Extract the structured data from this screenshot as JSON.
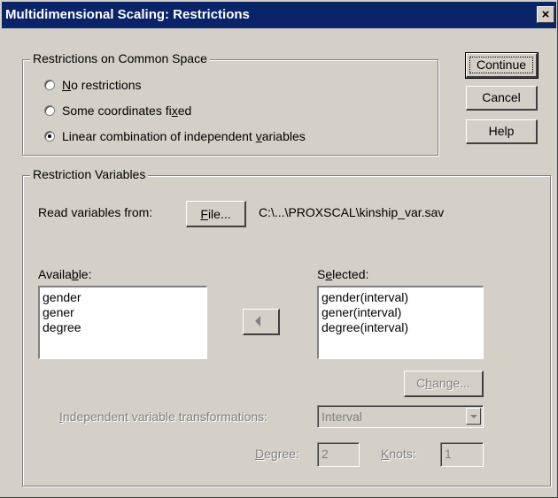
{
  "window": {
    "title": "Multidimensional Scaling: Restrictions",
    "close_glyph": "×"
  },
  "common_space": {
    "legend": "Restrictions on Common Space",
    "options": [
      {
        "pre": "",
        "key": "N",
        "post": "o restrictions",
        "selected": false
      },
      {
        "pre": "Some coordinates fi",
        "key": "x",
        "post": "ed",
        "selected": false
      },
      {
        "pre": "Linear combination of independent ",
        "key": "v",
        "post": "ariables",
        "selected": true
      }
    ]
  },
  "buttons": {
    "continue": "Continue",
    "cancel": "Cancel",
    "help": "Help"
  },
  "restriction_variables": {
    "legend": "Restriction Variables",
    "read_label": "Read variables from:",
    "file_button": {
      "key": "F",
      "post": "ile..."
    },
    "file_path": "C:\\...\\PROXSCAL\\kinship_var.sav",
    "available_label": {
      "pre": "Availa",
      "key": "b",
      "post": "le:"
    },
    "available_items": [
      "gender",
      "gener",
      "degree"
    ],
    "selected_label": {
      "pre": "S",
      "key": "e",
      "post": "lected:"
    },
    "selected_items": [
      "gender(interval)",
      "gener(interval)",
      "degree(interval)"
    ],
    "change_button": {
      "pre": "C",
      "key": "h",
      "post": "ange..."
    },
    "transform_label": {
      "pre": "",
      "key": "I",
      "post": "ndependent variable transformations:"
    },
    "transform_value": "Interval",
    "degree_label": {
      "pre": "",
      "key": "D",
      "post": "egree:"
    },
    "degree_value": "2",
    "knots_label": {
      "pre": "",
      "key": "K",
      "post": "nots:"
    },
    "knots_value": "1"
  }
}
